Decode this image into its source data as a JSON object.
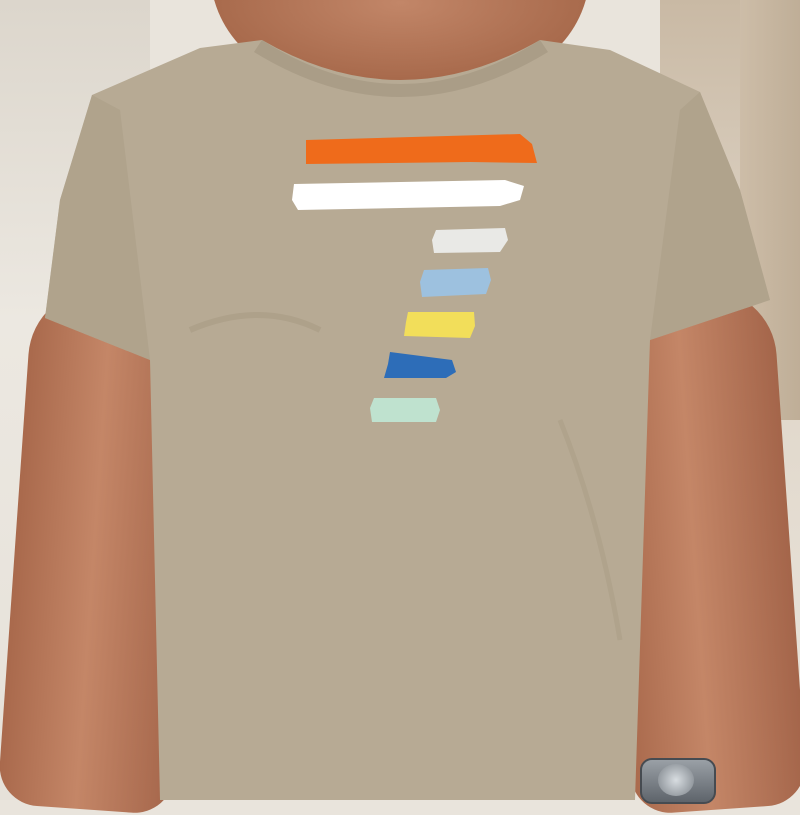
{
  "image": {
    "subject": "t-shirt",
    "colors": {
      "background": "#e9e4dc",
      "shirt": "#b7aa94",
      "shirt_shadow": "#a99c86",
      "skin": "#b9785a"
    }
  },
  "print": {
    "stripes": [
      {
        "color": "#ef6b1b"
      },
      {
        "color": "#ffffff"
      },
      {
        "color": "#e9e9e6"
      },
      {
        "color": "#9dc1df"
      },
      {
        "color": "#f2de5a"
      },
      {
        "color": "#2d6db8"
      },
      {
        "color": "#bfe2cf"
      }
    ]
  }
}
